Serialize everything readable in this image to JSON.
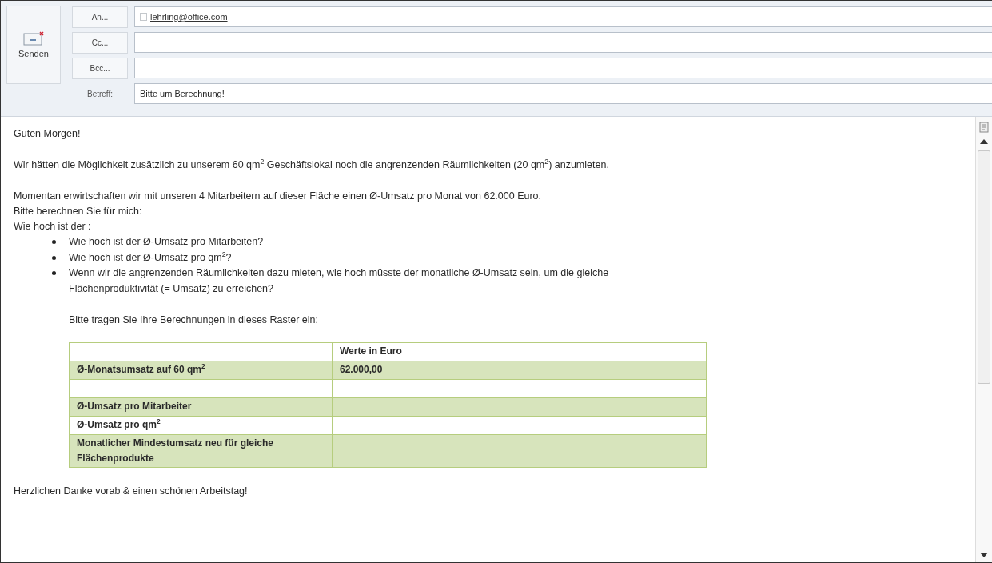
{
  "send_button": {
    "label": "Senden"
  },
  "address_fields": [
    {
      "button": "An...",
      "value": "lehrling@office.com"
    },
    {
      "button": "Cc..."
    },
    {
      "button": "Bcc..."
    }
  ],
  "subject": {
    "label": "Betreff:",
    "value": "Bitte um Berechnung!"
  },
  "body": {
    "greeting": "Guten Morgen!",
    "paragraph_1": "Wir hätten die Möglichkeit zusätzlich zu unserem 60 qm$^{2}$ Geschäftslokal noch die angrenzenden Räumlichkeiten (20 qm$^{2}$) anzumieten.",
    "lines": [
      "Momentan erwirtschaften wir mit unseren 4 Mitarbeitern auf dieser Fläche einen Ø-Umsatz pro Monat von 62.000 Euro.",
      "Bitte berechnen Sie für mich:",
      "Wie hoch ist der :"
    ],
    "bullets": [
      "Wie hoch ist der Ø-Umsatz pro Mitarbeiten?",
      "Wie hoch ist der Ø-Umsatz pro qm$^{2}$?",
      "Wenn wir die angrenzenden Räumlichkeiten dazu mieten, wie hoch müsste der monatliche Ø-Umsatz sein, um die gleiche Flächenproduktivität (= Umsatz) zu erreichen?"
    ],
    "table_intro": "Bitte tragen Sie Ihre Berechnungen in dieses Raster ein:",
    "table": {
      "value_header": "Werte in Euro",
      "rows": [
        {
          "label": "Ø-Monatsumsatz auf 60 qm$^{2}$",
          "value": "62.000,00"
        },
        {},
        {
          "label": "Ø-Umsatz pro Mitarbeiter"
        },
        {
          "label": "Ø-Umsatz pro qm$^{2}$"
        },
        {
          "label": "Monatlicher Mindestumsatz neu für gleiche Flächenprodukte"
        }
      ]
    },
    "closing": "Herzlichen Danke vorab & einen schönen Arbeitstag!"
  }
}
